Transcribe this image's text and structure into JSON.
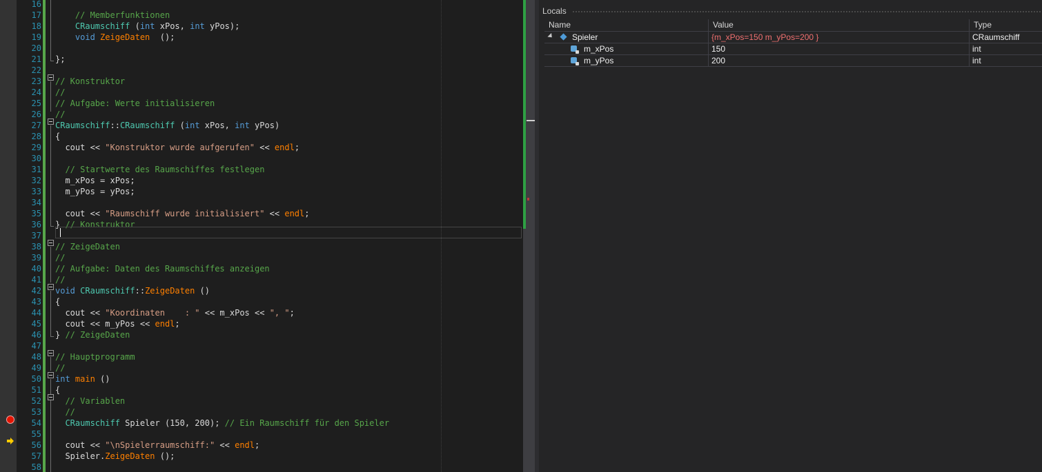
{
  "editor": {
    "lines": [
      {
        "n": "16",
        "segs": []
      },
      {
        "n": "17",
        "segs": [
          {
            "c": "cm",
            "t": "    // Memberfunktionen"
          }
        ]
      },
      {
        "n": "18",
        "segs": [
          {
            "c": "ty",
            "t": "    CRaumschiff"
          },
          {
            "c": "id",
            "t": " ("
          },
          {
            "c": "kw",
            "t": "int"
          },
          {
            "c": "id",
            "t": " xPos, "
          },
          {
            "c": "kw",
            "t": "int"
          },
          {
            "c": "id",
            "t": " yPos);"
          }
        ]
      },
      {
        "n": "19",
        "segs": [
          {
            "c": "kw",
            "t": "    void"
          },
          {
            "c": "id",
            "t": " "
          },
          {
            "c": "fn",
            "t": "ZeigeDaten"
          },
          {
            "c": "id",
            "t": "  ();"
          }
        ]
      },
      {
        "n": "20",
        "segs": []
      },
      {
        "n": "21",
        "segs": [
          {
            "c": "id",
            "t": "};"
          }
        ]
      },
      {
        "n": "22",
        "segs": []
      },
      {
        "n": "23",
        "segs": [
          {
            "c": "cm",
            "t": "// Konstruktor"
          }
        ]
      },
      {
        "n": "24",
        "segs": [
          {
            "c": "cm",
            "t": "//"
          }
        ]
      },
      {
        "n": "25",
        "segs": [
          {
            "c": "cm",
            "t": "// Aufgabe: Werte initialisieren"
          }
        ]
      },
      {
        "n": "26",
        "segs": [
          {
            "c": "cm",
            "t": "//"
          }
        ]
      },
      {
        "n": "27",
        "segs": [
          {
            "c": "ty",
            "t": "CRaumschiff"
          },
          {
            "c": "id",
            "t": "::"
          },
          {
            "c": "ty",
            "t": "CRaumschiff"
          },
          {
            "c": "id",
            "t": " ("
          },
          {
            "c": "kw",
            "t": "int"
          },
          {
            "c": "id",
            "t": " xPos, "
          },
          {
            "c": "kw",
            "t": "int"
          },
          {
            "c": "id",
            "t": " yPos)"
          }
        ]
      },
      {
        "n": "28",
        "segs": [
          {
            "c": "id",
            "t": "{"
          }
        ]
      },
      {
        "n": "29",
        "segs": [
          {
            "c": "id",
            "t": "  cout << "
          },
          {
            "c": "st",
            "t": "\"Konstruktor wurde aufgerufen\""
          },
          {
            "c": "id",
            "t": " << "
          },
          {
            "c": "fn",
            "t": "endl"
          },
          {
            "c": "id",
            "t": ";"
          }
        ]
      },
      {
        "n": "30",
        "segs": []
      },
      {
        "n": "31",
        "segs": [
          {
            "c": "cm",
            "t": "  // Startwerte des Raumschiffes festlegen"
          }
        ]
      },
      {
        "n": "32",
        "segs": [
          {
            "c": "id",
            "t": "  m_xPos = xPos;"
          }
        ]
      },
      {
        "n": "33",
        "segs": [
          {
            "c": "id",
            "t": "  m_yPos = yPos;"
          }
        ]
      },
      {
        "n": "34",
        "segs": []
      },
      {
        "n": "35",
        "segs": [
          {
            "c": "id",
            "t": "  cout << "
          },
          {
            "c": "st",
            "t": "\"Raumschiff wurde initialisiert\""
          },
          {
            "c": "id",
            "t": " << "
          },
          {
            "c": "fn",
            "t": "endl"
          },
          {
            "c": "id",
            "t": ";"
          }
        ]
      },
      {
        "n": "36",
        "segs": [
          {
            "c": "id",
            "t": "} "
          },
          {
            "c": "cm",
            "t": "// Konstruktor"
          }
        ]
      },
      {
        "n": "37",
        "segs": []
      },
      {
        "n": "38",
        "segs": [
          {
            "c": "cm",
            "t": "// ZeigeDaten"
          }
        ]
      },
      {
        "n": "39",
        "segs": [
          {
            "c": "cm",
            "t": "//"
          }
        ]
      },
      {
        "n": "40",
        "segs": [
          {
            "c": "cm",
            "t": "// Aufgabe: Daten des Raumschiffes anzeigen"
          }
        ]
      },
      {
        "n": "41",
        "segs": [
          {
            "c": "cm",
            "t": "//"
          }
        ]
      },
      {
        "n": "42",
        "segs": [
          {
            "c": "kw",
            "t": "void"
          },
          {
            "c": "id",
            "t": " "
          },
          {
            "c": "ty",
            "t": "CRaumschiff"
          },
          {
            "c": "id",
            "t": "::"
          },
          {
            "c": "fn",
            "t": "ZeigeDaten"
          },
          {
            "c": "id",
            "t": " ()"
          }
        ]
      },
      {
        "n": "43",
        "segs": [
          {
            "c": "id",
            "t": "{"
          }
        ]
      },
      {
        "n": "44",
        "segs": [
          {
            "c": "id",
            "t": "  cout << "
          },
          {
            "c": "st",
            "t": "\"Koordinaten    : \""
          },
          {
            "c": "id",
            "t": " << m_xPos << "
          },
          {
            "c": "st",
            "t": "\", \""
          },
          {
            "c": "id",
            "t": ";"
          }
        ]
      },
      {
        "n": "45",
        "segs": [
          {
            "c": "id",
            "t": "  cout << m_yPos << "
          },
          {
            "c": "fn",
            "t": "endl"
          },
          {
            "c": "id",
            "t": ";"
          }
        ]
      },
      {
        "n": "46",
        "segs": [
          {
            "c": "id",
            "t": "} "
          },
          {
            "c": "cm",
            "t": "// ZeigeDaten"
          }
        ]
      },
      {
        "n": "47",
        "segs": []
      },
      {
        "n": "48",
        "segs": [
          {
            "c": "cm",
            "t": "// Hauptprogramm"
          }
        ]
      },
      {
        "n": "49",
        "segs": [
          {
            "c": "cm",
            "t": "//"
          }
        ]
      },
      {
        "n": "50",
        "segs": [
          {
            "c": "kw",
            "t": "int"
          },
          {
            "c": "id",
            "t": " "
          },
          {
            "c": "fn",
            "t": "main"
          },
          {
            "c": "id",
            "t": " ()"
          }
        ]
      },
      {
        "n": "51",
        "segs": [
          {
            "c": "id",
            "t": "{"
          }
        ]
      },
      {
        "n": "52",
        "segs": [
          {
            "c": "cm",
            "t": "  // Variablen"
          }
        ]
      },
      {
        "n": "53",
        "segs": [
          {
            "c": "cm",
            "t": "  //"
          }
        ]
      },
      {
        "n": "54",
        "segs": [
          {
            "c": "ty",
            "t": "  CRaumschiff"
          },
          {
            "c": "id",
            "t": " Spieler (150, 200); "
          },
          {
            "c": "cm",
            "t": "// Ein Raumschiff für den Spieler"
          }
        ]
      },
      {
        "n": "55",
        "segs": []
      },
      {
        "n": "56",
        "segs": [
          {
            "c": "id",
            "t": "  cout << "
          },
          {
            "c": "st",
            "t": "\"\\nSpielerraumschiff:\""
          },
          {
            "c": "id",
            "t": " << "
          },
          {
            "c": "fn",
            "t": "endl"
          },
          {
            "c": "id",
            "t": ";"
          }
        ]
      },
      {
        "n": "57",
        "segs": [
          {
            "c": "id",
            "t": "  Spieler."
          },
          {
            "c": "fn",
            "t": "ZeigeDaten"
          },
          {
            "c": "id",
            "t": " ();"
          }
        ]
      },
      {
        "n": "58",
        "segs": []
      }
    ],
    "breakpoint_line": "54",
    "current_statement_line": "56",
    "caret_line": "37"
  },
  "locals": {
    "title": "Locals",
    "columns": {
      "name": "Name",
      "value": "Value",
      "type": "Type"
    },
    "rows": [
      {
        "name": "Spieler",
        "value": "{m_xPos=150 m_yPos=200 }",
        "type": "CRaumschiff",
        "expanded": true,
        "icon": "object-icon",
        "changed": true
      },
      {
        "name": "m_xPos",
        "value": "150",
        "type": "int",
        "icon": "private-field-icon"
      },
      {
        "name": "m_yPos",
        "value": "200",
        "type": "int",
        "icon": "private-field-icon"
      }
    ]
  },
  "colors": {
    "keyword": "#569cd6",
    "comment": "#57a64a",
    "string": "#d69d85",
    "type": "#4ec9b0",
    "function": "#ff8000",
    "line_number": "#2b91af",
    "breakpoint": "#e51400",
    "changed_value": "#f07070"
  }
}
